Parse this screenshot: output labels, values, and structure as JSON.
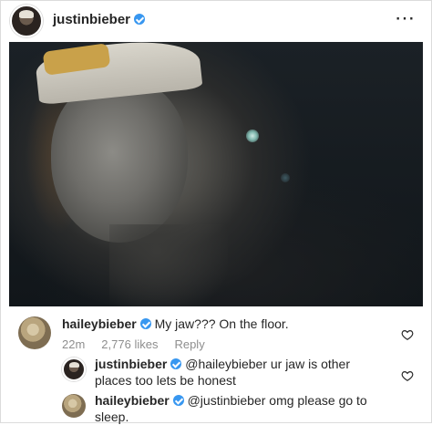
{
  "post": {
    "author": "justinbieber",
    "more_icon": "⋯"
  },
  "comments": [
    {
      "user": "haileybieber",
      "text": "My jaw??? On the floor.",
      "time": "22m",
      "likes": "2,776 likes",
      "reply": "Reply"
    },
    {
      "user": "justinbieber",
      "mention": "@haileybieber",
      "text_line1": "ur jaw is other",
      "text_line2": "places too lets be honest"
    },
    {
      "user": "haileybieber",
      "mention": "@justinbieber",
      "text_line1": "omg please go to",
      "text_line2": "sleep."
    }
  ],
  "colors": {
    "verified": "#3897f0",
    "meta": "#8e8e8e",
    "text": "#262626"
  }
}
